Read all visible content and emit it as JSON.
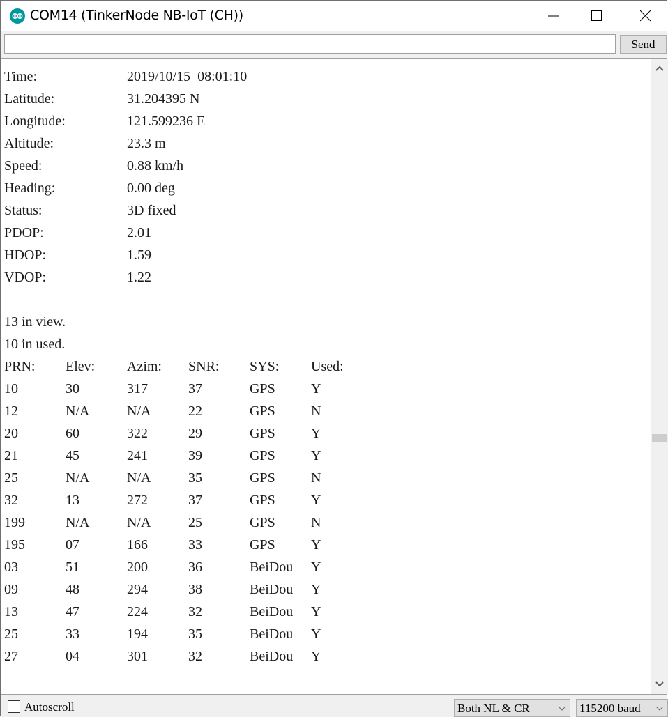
{
  "window": {
    "title": "COM14 (TinkerNode NB-IoT (CH))",
    "icon": "arduino-infinity-icon",
    "controls": [
      "minimize-icon",
      "maximize-icon",
      "close-icon"
    ]
  },
  "send_row": {
    "input_value": "",
    "send_label": "Send"
  },
  "output": {
    "fields": [
      {
        "label": "Time:",
        "value": "2019/10/15  08:01:10"
      },
      {
        "label": "Latitude:",
        "value": "31.204395 N"
      },
      {
        "label": "Longitude:",
        "value": "121.599236 E"
      },
      {
        "label": "Altitude:",
        "value": "23.3 m"
      },
      {
        "label": "Speed:",
        "value": "0.88 km/h"
      },
      {
        "label": "Heading:",
        "value": "0.00 deg"
      },
      {
        "label": "Status:",
        "value": "3D fixed"
      },
      {
        "label": "PDOP:",
        "value": "2.01"
      },
      {
        "label": "HDOP:",
        "value": "1.59"
      },
      {
        "label": "VDOP:",
        "value": "1.22"
      }
    ],
    "in_view": "13 in view.",
    "in_used": "10 in used.",
    "sat_headers": [
      "PRN:",
      "Elev:",
      "Azim:",
      "SNR:",
      "SYS:",
      "Used:"
    ],
    "satellites": [
      [
        "10",
        "30",
        "317",
        "37",
        "GPS",
        "Y"
      ],
      [
        "12",
        "N/A",
        "N/A",
        "22",
        "GPS",
        "N"
      ],
      [
        "20",
        "60",
        "322",
        "29",
        "GPS",
        "Y"
      ],
      [
        "21",
        "45",
        "241",
        "39",
        "GPS",
        "Y"
      ],
      [
        "25",
        "N/A",
        "N/A",
        "35",
        "GPS",
        "N"
      ],
      [
        "32",
        "13",
        "272",
        "37",
        "GPS",
        "Y"
      ],
      [
        "199",
        "N/A",
        "N/A",
        "25",
        "GPS",
        "N"
      ],
      [
        "195",
        "07",
        "166",
        "33",
        "GPS",
        "Y"
      ],
      [
        "03",
        "51",
        "200",
        "36",
        "BeiDou",
        "Y"
      ],
      [
        "09",
        "48",
        "294",
        "38",
        "BeiDou",
        "Y"
      ],
      [
        "13",
        "47",
        "224",
        "32",
        "BeiDou",
        "Y"
      ],
      [
        "25",
        "33",
        "194",
        "35",
        "BeiDou",
        "Y"
      ],
      [
        "27",
        "04",
        "301",
        "32",
        "BeiDou",
        "Y"
      ]
    ]
  },
  "bottom_bar": {
    "autoscroll_label": "Autoscroll",
    "autoscroll_checked": false,
    "line_ending": "Both NL & CR",
    "baud_rate": "115200 baud"
  },
  "colors": {
    "accent": "#00979c",
    "chrome_bg": "#f0f0f0",
    "text": "#1a1a1a"
  }
}
